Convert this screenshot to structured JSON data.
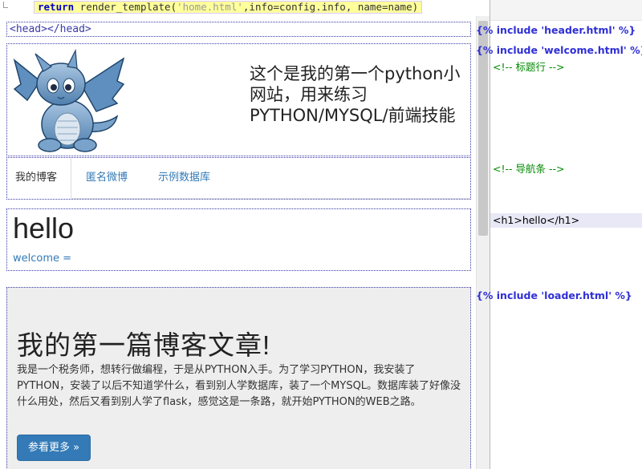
{
  "code": {
    "keyword": "return",
    "call": " render_template(",
    "template_arg": "'home.html'",
    "rest": ",info=config.info, name=name)"
  },
  "preview": {
    "head_tag": "<head></head>",
    "header": {
      "title": "这个是我的第一个python小网站，用来练习PYTHON/MYSQL/前端技能"
    },
    "nav": {
      "tabs": [
        {
          "label": "我的博客",
          "active": true
        },
        {
          "label": "匿名微博",
          "active": false
        },
        {
          "label": "示例数据库",
          "active": false
        }
      ]
    },
    "welcome": {
      "heading": "hello",
      "line": "welcome ="
    },
    "post": {
      "title": "我的第一篇博客文章!",
      "body": "我是一个税务师，想转行做编程，于是从PYTHON入手。为了学习PYTHON，我安装了PYTHON，安装了以后不知道学什么，看到别人学数据库，装了一个MYSQL。数据库装了好像没什么用处，然后又看到别人学了flask，感觉这是一条路，就开始PYTHON的WEB之路。",
      "button": "参看更多 »"
    }
  },
  "annotations": {
    "include_header": "{% include 'header.html' %}",
    "include_welcome": "{% include 'welcome.html' %}",
    "comment_title": "<!-- 标题行 -->",
    "comment_nav": "<!-- 导航条 -->",
    "h1": "<h1>hello</h1>",
    "include_loader": "{% include 'loader.html' %}"
  },
  "colors": {
    "accent": "#337ab7",
    "include": "#2f2fd6",
    "comment": "#008a00",
    "highlight": "#ffff9c"
  },
  "icons": {
    "logo": "dragon-mascot-image"
  }
}
